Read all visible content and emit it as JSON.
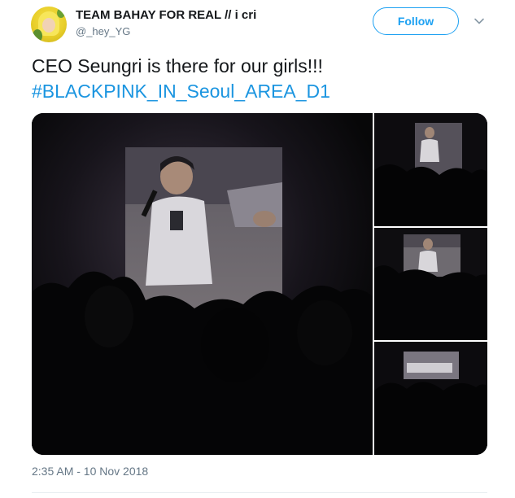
{
  "author": {
    "display_name": "TEAM BAHAY FOR REAL // i cri",
    "handle": "@_hey_YG",
    "avatar": "avatar-image"
  },
  "actions": {
    "follow_label": "Follow",
    "more_icon": "chevron-down-icon"
  },
  "tweet": {
    "text": "CEO Seungri is there for our girls!!!",
    "hashtag": "#BLACKPINK_IN_Seoul_AREA_D1",
    "timestamp": "2:35 AM - 10 Nov 2018"
  },
  "media": {
    "photo_count": 4
  },
  "colors": {
    "link": "#1b95e0",
    "follow": "#1da1f2",
    "muted": "#657786",
    "text": "#14171a"
  }
}
